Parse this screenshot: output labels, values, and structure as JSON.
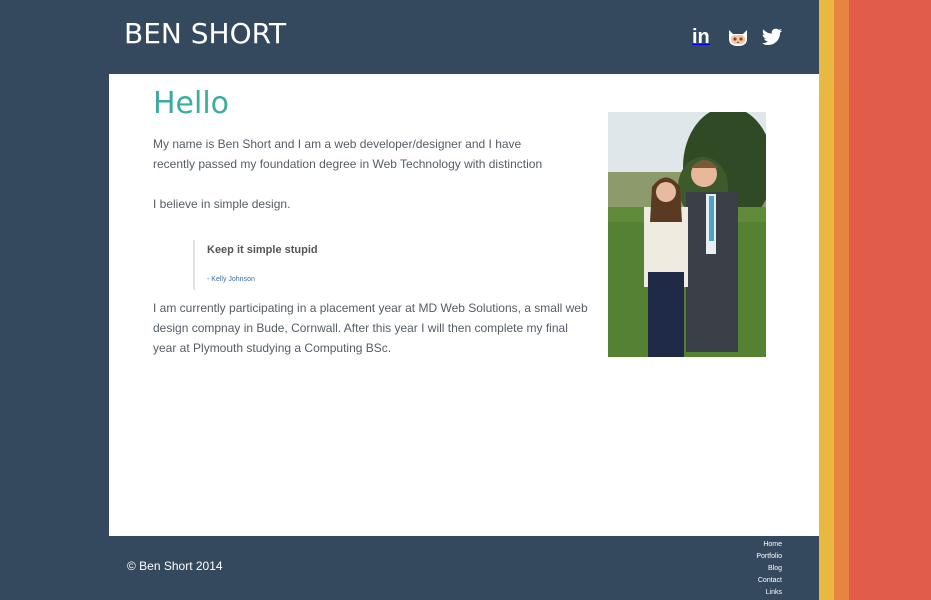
{
  "header": {
    "site_title": "BEN SHORT"
  },
  "social": [
    {
      "icon": "linkedin-icon",
      "label": "in"
    },
    {
      "icon": "github-icon"
    },
    {
      "icon": "twitter-icon"
    }
  ],
  "main": {
    "heading": "Hello",
    "intro": "My name is Ben Short and I am a web developer/designer and I have recently passed my foundation degree in Web Technology with distinction",
    "belief": "I believe in simple design.",
    "quote": {
      "text": "Keep it simple stupid",
      "author": "- Kelly Johnson"
    },
    "placement": "I am currently participating in a placement year at MD Web Solutions, a small web design compnay in Bude, Cornwall.  After this year I will then complete my final year at Plymouth studying a Computing BSc."
  },
  "footer": {
    "copyright": "© Ben Short 2014",
    "nav": [
      "Home",
      "Portfolio",
      "Blog",
      "Contact",
      "Links"
    ]
  },
  "colors": {
    "background": "#34495e",
    "accent": "#3aada0",
    "stripe_yellow": "#e9b840",
    "stripe_orange": "#e5853f",
    "stripe_red": "#e25c4a"
  }
}
